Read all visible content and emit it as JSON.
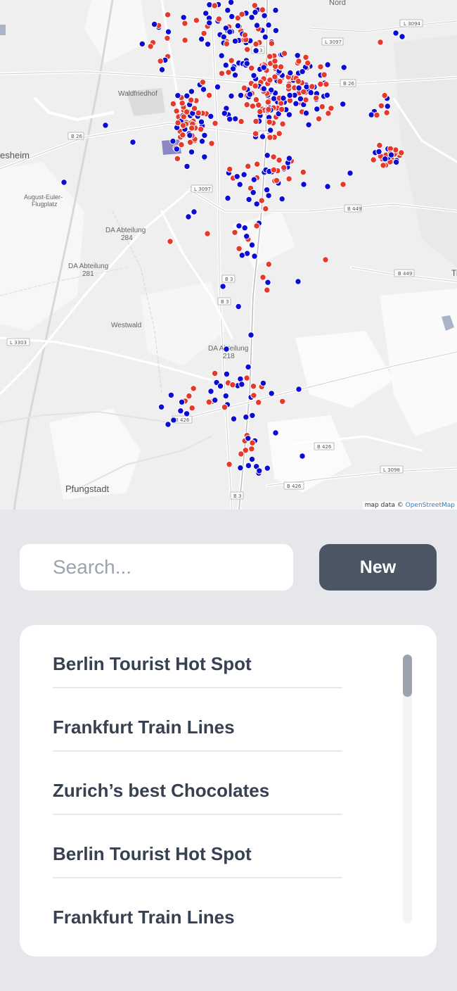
{
  "map": {
    "labels": {
      "nord": "Nord",
      "waldfriedhof": "Waldfriedhof",
      "esheim": "esheim",
      "august_euler": "August-Euler-",
      "flugplatz": "Flugplatz",
      "da_abteilung_284_a": "DA Abteilung",
      "da_abteilung_284_b": "284",
      "da_abteilung_281_a": "DA Abteilung",
      "da_abteilung_281_b": "281",
      "westwald": "Westwald",
      "da_abteilung_218_a": "DA Abteilung",
      "da_abteilung_218_b": "218",
      "pfungstadt": "Pfungstadt",
      "tr": "Tr"
    },
    "shields": {
      "l3094": "L 3094",
      "l3097_top": "L 3097",
      "b3_top": "B 3",
      "b26_right": "B 26",
      "b26_left": "B 26",
      "l3097_mid": "L 3097",
      "b449_mid": "B 449",
      "b449_right": "B 449",
      "b3_mid1": "B 3",
      "b3_mid2": "B 3",
      "l3303": "L 3303",
      "b426_left": "B 426",
      "b426_right": "B 426",
      "l3098": "L 3098",
      "b426_bottom": "B 426",
      "b3_bottom": "B 3",
      "b3_city": "B 3"
    },
    "attribution_prefix": "map data © ",
    "attribution_link": "OpenStreetMap",
    "marker_colors": {
      "red": "#e5392b",
      "blue": "#0b0bd6"
    }
  },
  "search": {
    "placeholder": "Search...",
    "value": ""
  },
  "new_button": {
    "label": "New"
  },
  "list": {
    "items": [
      {
        "label": "Berlin Tourist Hot Spot"
      },
      {
        "label": "Frankfurt Train Lines"
      },
      {
        "label": "Zurich’s best Chocolates"
      },
      {
        "label": "Berlin Tourist Hot Spot"
      },
      {
        "label": "Frankfurt Train Lines"
      }
    ]
  }
}
